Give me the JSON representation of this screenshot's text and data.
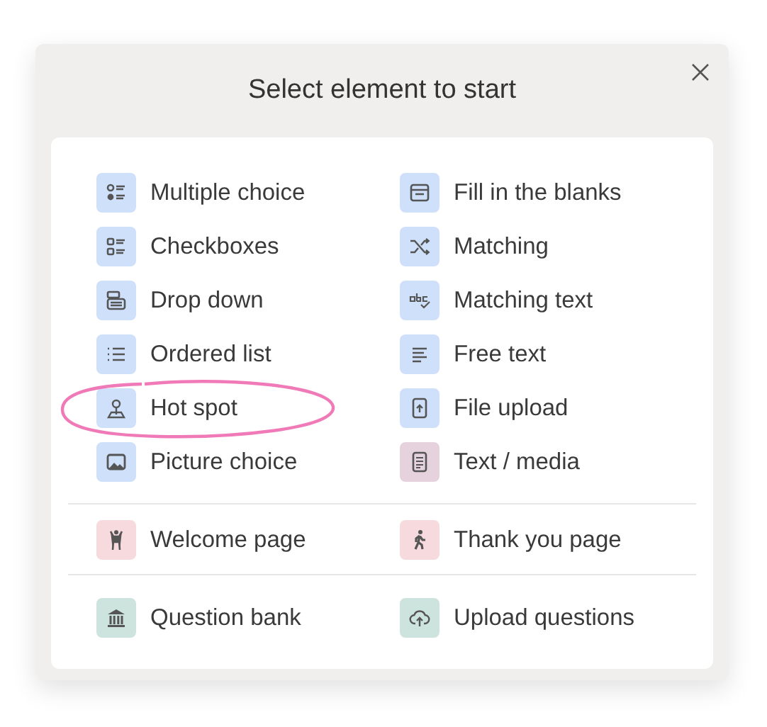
{
  "dialog": {
    "title": "Select element to start"
  },
  "sections": [
    {
      "items": [
        {
          "label": "Multiple choice",
          "color": "#cfe0fb"
        },
        {
          "label": "Fill in the blanks",
          "color": "#cfe0fb"
        },
        {
          "label": "Checkboxes",
          "color": "#cfe0fb"
        },
        {
          "label": "Matching",
          "color": "#cfe0fb"
        },
        {
          "label": "Drop down",
          "color": "#cfe0fb"
        },
        {
          "label": "Matching text",
          "color": "#cfe0fb"
        },
        {
          "label": "Ordered list",
          "color": "#cfe0fb"
        },
        {
          "label": "Free text",
          "color": "#cfe0fb"
        },
        {
          "label": "Hot spot",
          "color": "#cfe0fb"
        },
        {
          "label": "File upload",
          "color": "#cfe0fb"
        },
        {
          "label": "Picture choice",
          "color": "#cfe0fb"
        },
        {
          "label": "Text / media",
          "color": "#e6d2dc"
        }
      ]
    },
    {
      "items": [
        {
          "label": "Welcome page",
          "color": "#f7dadd"
        },
        {
          "label": "Thank you page",
          "color": "#f7dadd"
        }
      ]
    },
    {
      "items": [
        {
          "label": "Question bank",
          "color": "#cde3de"
        },
        {
          "label": "Upload questions",
          "color": "#cde3de"
        }
      ]
    }
  ]
}
